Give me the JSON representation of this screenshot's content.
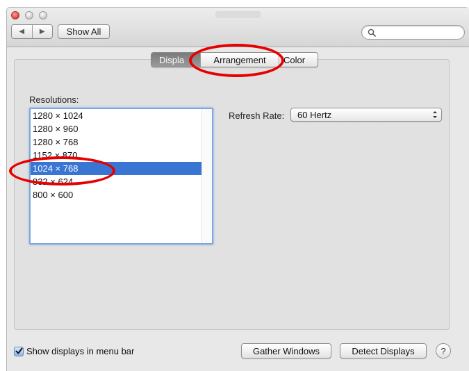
{
  "toolbar": {
    "back_glyph": "◀",
    "forward_glyph": "▶",
    "show_all_label": "Show All",
    "search_placeholder": "",
    "search_value": ""
  },
  "tabs": [
    {
      "label": "Display",
      "visible_label": "Displa",
      "active": true
    },
    {
      "label": "Arrangement",
      "active": false
    },
    {
      "label": "Color",
      "visible_label": "Color",
      "active": false
    }
  ],
  "resolutions": {
    "label": "Resolutions:",
    "items": [
      "1280 × 1024",
      "1280 × 960",
      "1280 × 768",
      "1152 × 870",
      "1024 × 768",
      "832 × 624",
      "800 × 600"
    ],
    "selected": "1024 × 768"
  },
  "refresh_rate": {
    "label": "Refresh Rate:",
    "value": "60 Hertz"
  },
  "bottom": {
    "show_in_menu_bar_label": "Show displays in menu bar",
    "show_in_menu_bar_checked": true,
    "gather_windows_label": "Gather Windows",
    "detect_displays_label": "Detect Displays",
    "help_label": "?"
  },
  "colors": {
    "selection": "#3a75d4",
    "annotation": "#e60000",
    "focus_ring": "#7ea6dc"
  },
  "icons": [
    "close-button-icon",
    "minimize-button-icon",
    "zoom-button-icon",
    "search-icon",
    "chevron-up-down-icon",
    "checkmark-icon"
  ]
}
